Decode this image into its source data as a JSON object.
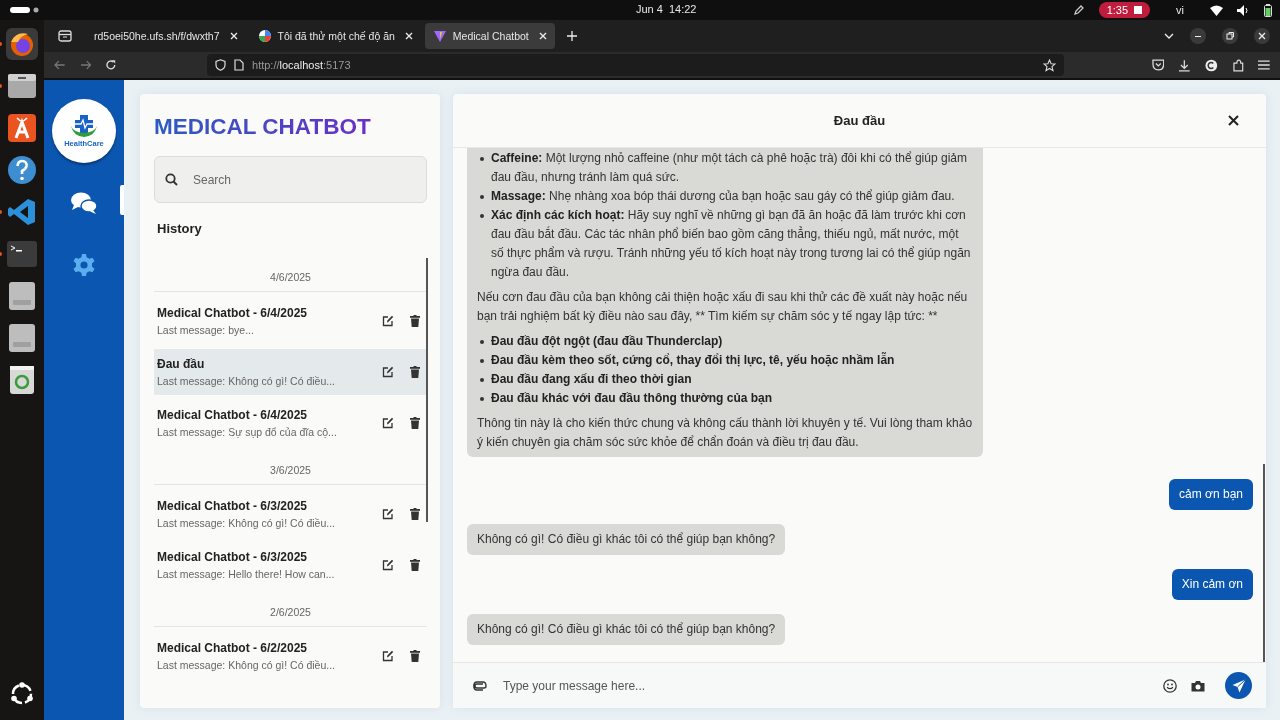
{
  "system_bar": {
    "date": "Jun 4",
    "time": "14:22",
    "recording": "1:35",
    "language": "vi"
  },
  "browser": {
    "tabs": [
      {
        "title": "rd5oei50he.ufs.sh/f/dwxth7",
        "selected": false
      },
      {
        "title": "Tôi đã thử một chế độ ăn",
        "kind": "circle",
        "selected": false
      },
      {
        "title": "Medical Chatbot",
        "kind": "triangle",
        "selected": true
      }
    ],
    "url": {
      "scheme": "http://",
      "host": "localhost",
      "port": ":5173"
    }
  },
  "app": {
    "logo_text": "HealthCare",
    "nav": [
      {
        "kind": "chat",
        "selected": true
      },
      {
        "kind": "settings",
        "selected": false
      }
    ],
    "title": "MEDICAL CHATBOT",
    "search": {
      "placeholder": "Search"
    },
    "history_heading": "History",
    "history": [
      {
        "date": "4/6/2025",
        "items": [
          {
            "title": "Medical Chatbot - 6/4/2025",
            "last_message": "Last message: bye...",
            "selected": false
          },
          {
            "title": "Đau đầu",
            "last_message": "Last message: Không có gì! Có điều...",
            "selected": true
          },
          {
            "title": "Medical Chatbot - 6/4/2025",
            "last_message": "Last message: Sự sụp đổ của đĩa cộ...",
            "selected": false
          }
        ]
      },
      {
        "date": "3/6/2025",
        "items": [
          {
            "title": "Medical Chatbot - 6/3/2025",
            "last_message": "Last message: Không có gì! Có điều...",
            "selected": false
          },
          {
            "title": "Medical Chatbot - 6/3/2025",
            "last_message": "Last message: Hello there! How can...",
            "selected": false
          }
        ]
      },
      {
        "date": "2/6/2025",
        "items": [
          {
            "title": "Medical Chatbot - 6/2/2025",
            "last_message": "Last message: Không có gì! Có điều...",
            "selected": false
          }
        ]
      }
    ],
    "chat": {
      "title": "Đau đầu",
      "messages": [
        {
          "kind": "bot",
          "blocks": [
            {
              "kind": "list",
              "items": [
                "**Caffeine:** Một lượng nhỏ caffeine (như một tách cà phê hoặc trà) đôi khi có thể giúp giảm đau đầu, nhưng tránh làm quá sức.",
                "**Massage:** Nhẹ nhàng xoa bóp thái dương của bạn hoặc sau gáy có thể giúp giảm đau.",
                "**Xác định các kích hoạt:** Hãy suy nghĩ về những gì bạn đã ăn hoặc đã làm trước khi cơn đau đầu bắt đầu. Các tác nhân phổ biến bao gồm căng thẳng, thiếu ngủ, mất nước, một số thực phẩm và rượu. Tránh những yếu tố kích hoạt này trong tương lai có thể giúp ngăn ngừa đau đầu."
              ]
            },
            {
              "kind": "paragraph",
              "text": "Nếu cơn đau đầu của bạn không cải thiện hoặc xấu đi sau khi thử các đề xuất này hoặc nếu bạn trải nghiệm bất kỳ điều nào sau đây, ** Tìm kiếm sự chăm sóc y tế ngay lập tức: **"
            },
            {
              "kind": "list",
              "items": [
                "**Đau đầu đột ngột (đau đầu Thunderclap)**",
                "**Đau đầu kèm theo sốt, cứng cổ, thay đổi thị lực, tê, yếu hoặc nhầm lẫn**",
                "**Đau đầu đang xấu đi theo thời gian**",
                "**Đau đầu khác với đau đầu thông thường của bạn**"
              ]
            },
            {
              "kind": "paragraph",
              "text": "Thông tin này là cho kiến thức chung và không cấu thành lời khuyên y tế. Vui lòng tham khảo ý kiến chuyên gia chăm sóc sức khỏe để chẩn đoán và điều trị đau đầu."
            }
          ]
        },
        {
          "kind": "user",
          "text": "cảm ơn bạn"
        },
        {
          "kind": "bot",
          "text": "Không có gì! Có điều gì khác tôi có thể giúp bạn không?"
        },
        {
          "kind": "user",
          "text": "Xin cảm ơn"
        },
        {
          "kind": "bot",
          "text": "Không có gì! Có điều gì khác tôi có thể giúp bạn không?"
        }
      ],
      "input": {
        "placeholder": "Type your message here..."
      }
    }
  }
}
